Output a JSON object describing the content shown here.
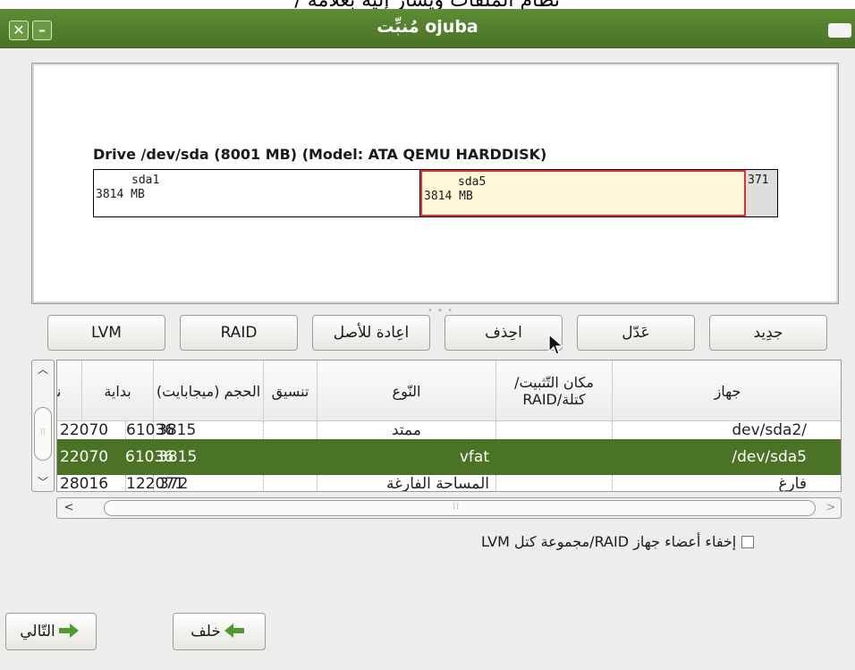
{
  "top_strip_text": "نظام الملفات ويشار إليه بعلامة /",
  "window": {
    "title": "مُنبِّت ojuba",
    "close_glyph": "✕",
    "minimize_glyph": "–"
  },
  "drive": {
    "title": "Drive /dev/sda (8001 MB) (Model: ATA QEMU HARDDISK)",
    "partitions": [
      {
        "name": "sda1",
        "size": "3814 MB"
      },
      {
        "name": "sda5",
        "size": "3814 MB"
      },
      {
        "name": "",
        "size": "371"
      }
    ]
  },
  "buttons": {
    "new": "جدِيد",
    "edit": "عَدّل",
    "delete": "احِذف",
    "reset": "اعِادة للأصل",
    "raid": "RAID",
    "lvm": "LVM"
  },
  "table": {
    "headers": {
      "device": "جهاز",
      "mount": "مكان التّثبيت/ كتلة/RAID",
      "type": "النّوع",
      "format": "تنسيق",
      "size": "الحجم (ميجابايت)",
      "start": "بداية",
      "end": "نهاية"
    },
    "rows": [
      {
        "device": "/dev/sda2",
        "mount": "",
        "type": "ممتد",
        "format": "",
        "size": "3815",
        "start": "61036",
        "end": "22070"
      },
      {
        "device": "/dev/sda5",
        "mount": "",
        "type": "vfat",
        "format": "",
        "size": "3815",
        "start": "61036",
        "end": "22070"
      },
      {
        "device": "فارغ",
        "mount": "",
        "type": "المساحة الفارغة",
        "format": "",
        "size": "372",
        "start": "122071",
        "end": "28016"
      }
    ]
  },
  "hide_members_label": "إخفاء أعضاء جهاز RAID/مجموعة كتل LVM",
  "nav": {
    "back": "خلف",
    "next": "التّالي"
  },
  "colors": {
    "accent_green": "#4a7326",
    "selected_partition_border": "#e03131",
    "selected_partition_fill": "#fff7d6"
  }
}
